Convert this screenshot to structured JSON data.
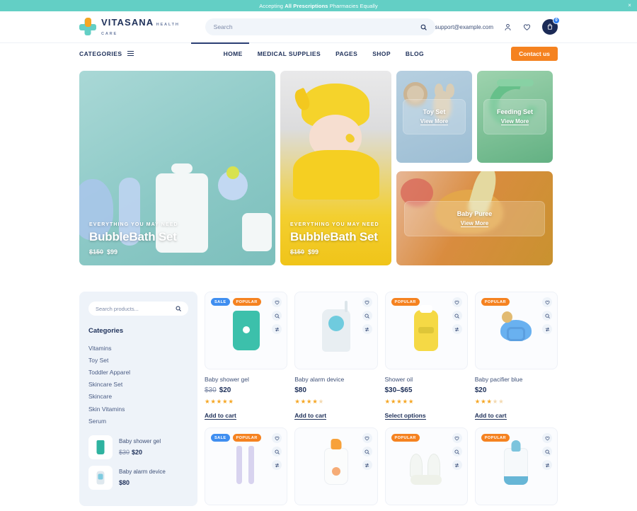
{
  "announcement": {
    "text_before": "Accepting ",
    "text_bold": "All Prescriptions",
    "text_after": " Pharmacies Equally",
    "close_label": "×"
  },
  "header": {
    "logo_name": "VITASANA",
    "logo_sub": "HEALTH CARE",
    "search_placeholder": "Search",
    "search_value": "",
    "support_email": "support@example.com",
    "cart_count": "0"
  },
  "nav": {
    "categories_label": "CATEGORIES",
    "links": [
      {
        "label": "HOME"
      },
      {
        "label": "MEDICAL SUPPLIES"
      },
      {
        "label": "PAGES"
      },
      {
        "label": "SHOP"
      },
      {
        "label": "BLOG"
      }
    ],
    "contact_label": "Contact us"
  },
  "hero": {
    "banners": [
      {
        "kicker": "EVERYTHING YOU MAY NEED",
        "title": "BubbleBath Set",
        "price_old": "$150",
        "price_new": "$99"
      },
      {
        "kicker": "EVERYTHING YOU MAY NEED",
        "title": "BubbleBath Set",
        "price_old": "$150",
        "price_new": "$99"
      }
    ],
    "cards": [
      {
        "title": "Toy Set",
        "link": "View More"
      },
      {
        "title": "Feeding Set",
        "link": "View More"
      },
      {
        "title": "Baby Puree",
        "link": "View More"
      }
    ]
  },
  "sidebar": {
    "search_placeholder": "Search products...",
    "search_value": "",
    "categories_title": "Categories",
    "categories": [
      {
        "label": "Vitamins"
      },
      {
        "label": "Toy Set"
      },
      {
        "label": "Toddler Apparel"
      },
      {
        "label": "Skincare Set"
      },
      {
        "label": "Skincare"
      },
      {
        "label": "Skin Vitamins"
      },
      {
        "label": "Serum"
      }
    ],
    "mini_products": [
      {
        "name": "Baby shower gel",
        "price_old": "$30",
        "price_new": "$20"
      },
      {
        "name": "Baby alarm device",
        "price_old": "",
        "price_new": "$80"
      }
    ]
  },
  "products": [
    {
      "name": "Baby shower gel",
      "price_old": "$30",
      "price_new": "$20",
      "rating": 5,
      "cta": "Add to cart",
      "badges": [
        "SALE",
        "POPULAR"
      ]
    },
    {
      "name": "Baby alarm device",
      "price_old": "",
      "price_new": "$80",
      "rating": 4,
      "cta": "Add to cart",
      "badges": []
    },
    {
      "name": "Shower oil",
      "price_old": "",
      "price_new": "$30–$65",
      "rating": 5,
      "cta": "Select options",
      "badges": [
        "POPULAR"
      ]
    },
    {
      "name": "Baby pacifier blue",
      "price_old": "",
      "price_new": "$20",
      "rating": 3,
      "cta": "Add to cart",
      "badges": [
        "POPULAR"
      ]
    },
    {
      "name": "",
      "price_old": "",
      "price_new": "",
      "rating": 0,
      "cta": "",
      "badges": [
        "SALE",
        "POPULAR"
      ]
    },
    {
      "name": "",
      "price_old": "",
      "price_new": "",
      "rating": 0,
      "cta": "",
      "badges": []
    },
    {
      "name": "",
      "price_old": "",
      "price_new": "",
      "rating": 0,
      "cta": "",
      "badges": [
        "POPULAR"
      ]
    },
    {
      "name": "",
      "price_old": "",
      "price_new": "",
      "rating": 0,
      "cta": "",
      "badges": [
        "POPULAR"
      ]
    }
  ],
  "colors": {
    "teal": "#63cfc5",
    "orange": "#f58220",
    "navy": "#20325b",
    "sale_blue": "#3f8ef0",
    "star": "#f5a623"
  }
}
